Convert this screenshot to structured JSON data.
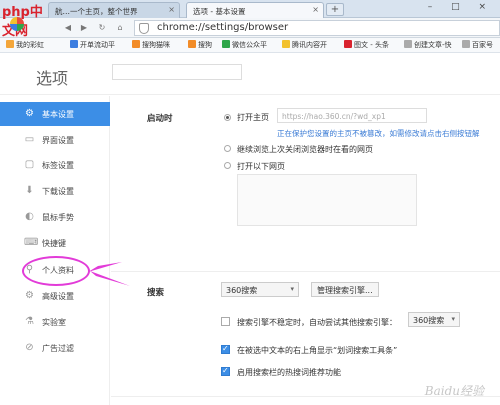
{
  "tabs": [
    {
      "label": "航…一个主页，整个世界",
      "active": false
    },
    {
      "label": "选项 - 基本设置",
      "active": true
    }
  ],
  "newtab": "+",
  "window_controls": "– □ ×",
  "address": {
    "url": "chrome://settings/browser"
  },
  "nav_icons": [
    "back-icon",
    "forward-icon",
    "refresh-icon",
    "home-icon"
  ],
  "bookmarks": [
    {
      "label": "我的彩虹",
      "color": "#f4a63a"
    },
    {
      "label": "开单流动平",
      "color": "#3b7de0"
    },
    {
      "label": "搜狗猫咪",
      "color": "#f28c28"
    },
    {
      "label": "搜狗",
      "color": "#f28c28"
    },
    {
      "label": "微信公众平",
      "color": "#2ea64a"
    },
    {
      "label": "腾讯内容开",
      "color": "#f2c12e"
    },
    {
      "label": "图文 - 头条",
      "color": "#d9232e"
    },
    {
      "label": "创建文章-快",
      "color": "#aaaaaa"
    },
    {
      "label": "百家号",
      "color": "#aaaaaa"
    }
  ],
  "logo_text": "php中文网",
  "page": {
    "title": "选项"
  },
  "sidebar": {
    "items": [
      {
        "label": "基本设置",
        "icon": "gear-icon",
        "glyph": "⚙",
        "active": true
      },
      {
        "label": "界面设置",
        "icon": "window-icon",
        "glyph": "▭",
        "active": false
      },
      {
        "label": "标签设置",
        "icon": "tab-icon",
        "glyph": "▢",
        "active": false
      },
      {
        "label": "下载设置",
        "icon": "download-icon",
        "glyph": "⬇",
        "active": false
      },
      {
        "label": "鼠标手势",
        "icon": "mouse-icon",
        "glyph": "◐",
        "active": false
      },
      {
        "label": "快捷键",
        "icon": "keyboard-icon",
        "glyph": "⌨",
        "active": false
      },
      {
        "label": "个人资料",
        "icon": "search-icon",
        "glyph": "⚲",
        "active": false
      },
      {
        "label": "高级设置",
        "icon": "advanced-icon",
        "glyph": "⚙",
        "active": false
      },
      {
        "label": "实验室",
        "icon": "lab-icon",
        "glyph": "⚗",
        "active": false
      },
      {
        "label": "广告过滤",
        "icon": "block-icon",
        "glyph": "⊘",
        "active": false
      }
    ]
  },
  "startup": {
    "label": "启动时",
    "option_homepage": "打开主页",
    "homepage_value": "https://hao.360.cn/?wd_xp1",
    "protect_note": "正在保护您设置的主页不被篡改，如需修改请点击右侧按钮解",
    "option_restore": "继续浏览上次关闭浏览器时在看的网页",
    "option_pages": "打开以下网页"
  },
  "search": {
    "label": "搜索",
    "engine": "360搜索",
    "manage_button": "管理搜索引擎...",
    "unstable_text": "搜索引擎不稳定时，自动尝试其他搜索引擎：",
    "fallback_engine": "360搜索",
    "opt_selection": "在被选中文本的右上角显示“划词搜索工具条”",
    "opt_hot": "启用搜索栏的热搜词推荐功能"
  },
  "watermark": "Baidu经验",
  "colors": {
    "accent": "#3c8ee6",
    "annotation": "#e23bd8",
    "link": "#3a7bd5"
  }
}
